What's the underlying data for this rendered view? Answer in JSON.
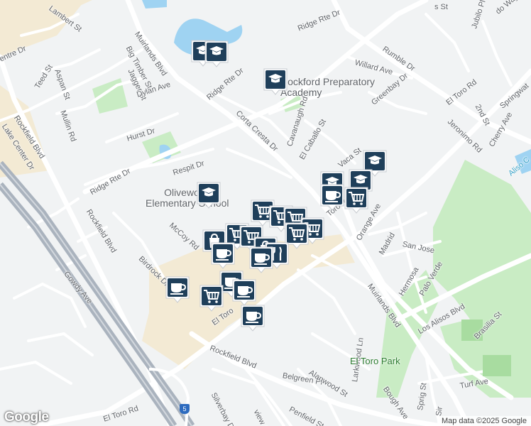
{
  "map": {
    "attribution": "Map data ©2025 Google",
    "logo": "Google",
    "highway_shield": "5",
    "colors": {
      "background": "#f1f3f4",
      "road": "#ffffff",
      "commercial": "#f3ead4",
      "park": "#c9ecc4",
      "water": "#9fd3f2",
      "freeway": "#aab3be",
      "pin": "#1f3f5a"
    }
  },
  "poi_labels": {
    "school_1": "Rockford Preparatory\nAcademy",
    "school_2": "Olivewood\nElementary School",
    "park": "El Toro Park"
  },
  "streets": {
    "lambert": "Lambert St",
    "entre": "entre Dr",
    "muirlands_top": "Muirlands Blvd",
    "big_timber": "Big Timber St",
    "aspan": "Aspan St",
    "teed": "Teed St",
    "jagger": "Jagger St",
    "dylan": "Dylan Ave",
    "mullin": "Mullin Rd",
    "rockfield_left": "Rockfield Blvd",
    "lake_center": "Lake Center Dr",
    "hurst": "Hurst Dr",
    "ridge_top": "Ridge Rte Dr",
    "ridge_mid": "Ridge Rte Dr",
    "ridge_left": "Ridge Rte Dr",
    "respit": "Respit Dr",
    "corta_cresta": "Corta Cresta Dr",
    "cavanaugh": "Cavanaugh Rd",
    "el_caballo": "El Caballo St",
    "willard": "Willard Ave",
    "rumble": "Rumble Dr",
    "greenbay": "Greenbay Dr",
    "jubilo": "Jubilo Pl",
    "do_way": "do Way",
    "s_st": "s St",
    "el_toro_rd_top": "El Toro Rd",
    "second_st": "2nd St",
    "springwater": "Springwat",
    "jeronimo": "Jeronimo Rd",
    "cherry": "Cherry Ave",
    "aliso": "Aliso C",
    "vaca": "Vaca St",
    "el_toro_mid": "Toro Rd",
    "orange": "Orange Ave",
    "madrid": "Madrid",
    "san_jose": "San Jose",
    "hermosa": "Hermosa",
    "palo_verde": "Palo Verde",
    "muirlands_bottom": "Muirlands Blvd",
    "los_alisos": "Los Alisos Blvd",
    "brasilia": "Brasilia St",
    "mccoy": "McCoy Rd",
    "birdrock": "Birdrock Dr",
    "rockfield_mid": "Rockfield Blvd",
    "gowdy": "Gowdy Ave",
    "el_toro_lower": "El Toro",
    "rockfield_bottom": "Rockfield Blvd",
    "belgreen": "Belgreen Pl",
    "alanwood": "Alanwood St",
    "larkwood": "Larkwood Ln",
    "bough": "Bough Ave",
    "turf": "Turf Ave",
    "silverbay": "Silverbay Dr",
    "view": "view Av",
    "penfield": "Penfield St",
    "el_toro_bottom": "El Toro Rd",
    "spring": "Sprig St",
    "sir": "Sir"
  },
  "pins": [
    {
      "name": "school-pin",
      "icon": "school-icon"
    },
    {
      "name": "school-pin",
      "icon": "school-icon"
    },
    {
      "name": "school-pin",
      "icon": "school-icon"
    },
    {
      "name": "school-pin",
      "icon": "school-icon"
    },
    {
      "name": "school-pin",
      "icon": "school-icon"
    },
    {
      "name": "school-pin",
      "icon": "school-icon"
    },
    {
      "name": "school-pin",
      "icon": "school-icon"
    },
    {
      "name": "cafe-pin",
      "icon": "coffee-cup-icon"
    },
    {
      "name": "grocery-pin",
      "icon": "shopping-cart-icon"
    },
    {
      "name": "grocery-pin",
      "icon": "shopping-cart-icon"
    },
    {
      "name": "grocery-pin",
      "icon": "shopping-cart-icon"
    },
    {
      "name": "grocery-pin",
      "icon": "shopping-cart-icon"
    },
    {
      "name": "grocery-pin",
      "icon": "shopping-cart-icon"
    },
    {
      "name": "grocery-pin",
      "icon": "shopping-cart-icon"
    },
    {
      "name": "grocery-pin",
      "icon": "shopping-cart-icon"
    },
    {
      "name": "grocery-pin",
      "icon": "shopping-cart-icon"
    },
    {
      "name": "shopping-pin",
      "icon": "shopping-bag-icon"
    },
    {
      "name": "shopping-pin",
      "icon": "shopping-bag-icon"
    },
    {
      "name": "restaurant-pin",
      "icon": "fork-knife-icon"
    },
    {
      "name": "cafe-pin",
      "icon": "coffee-cup-icon"
    },
    {
      "name": "cafe-pin",
      "icon": "coffee-cup-icon"
    },
    {
      "name": "cafe-pin",
      "icon": "coffee-cup-icon"
    },
    {
      "name": "cafe-pin",
      "icon": "coffee-cup-icon"
    },
    {
      "name": "cafe-pin",
      "icon": "coffee-cup-icon"
    },
    {
      "name": "grocery-pin",
      "icon": "shopping-cart-icon"
    },
    {
      "name": "cafe-pin",
      "icon": "coffee-cup-icon"
    }
  ]
}
